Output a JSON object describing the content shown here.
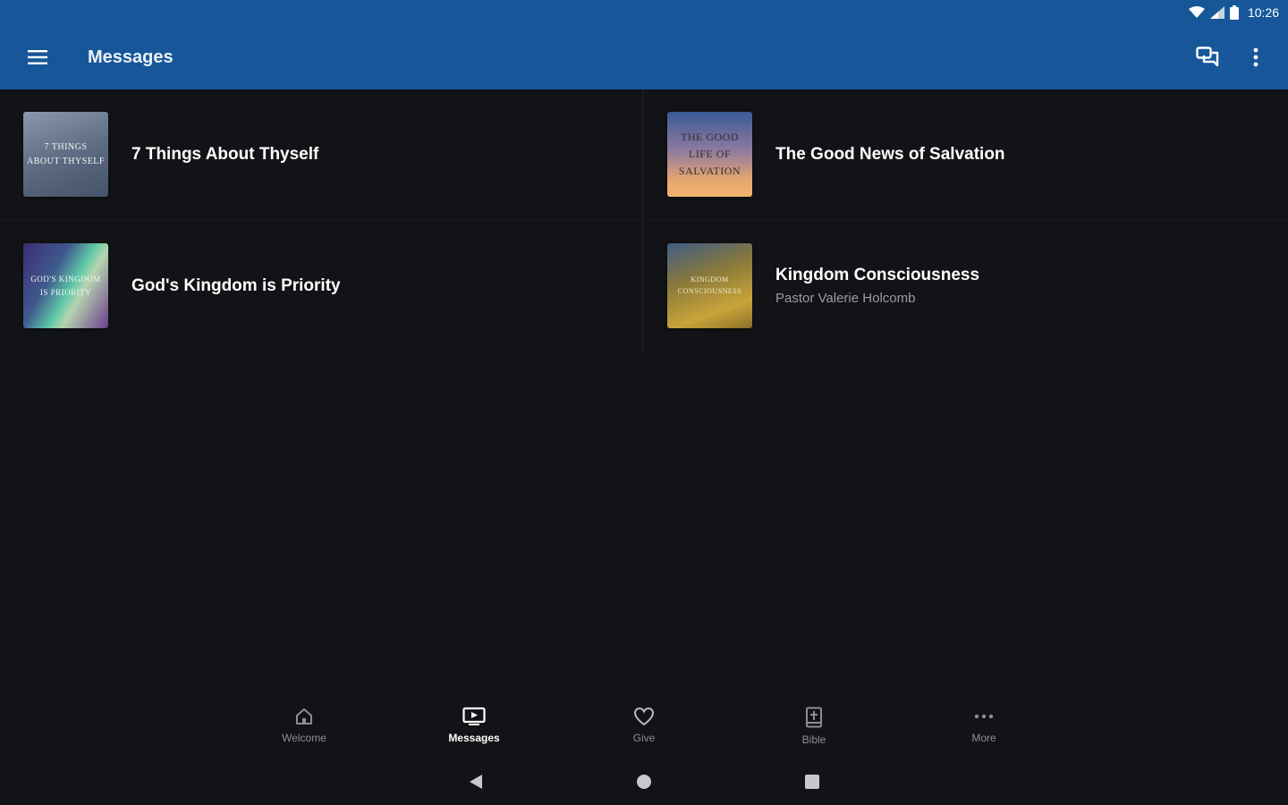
{
  "status": {
    "time": "10:26"
  },
  "appbar": {
    "title": "Messages"
  },
  "messages": [
    {
      "title": "7 Things About Thyself",
      "subtitle": "",
      "thumb_text": "7 Things About Thyself"
    },
    {
      "title": "The Good News of Salvation",
      "subtitle": "",
      "thumb_text": "The Good Life of Salvation"
    },
    {
      "title": "God's Kingdom is Priority",
      "subtitle": "",
      "thumb_text": "God's Kingdom is Priority"
    },
    {
      "title": "Kingdom Consciousness",
      "subtitle": "Pastor Valerie Holcomb",
      "thumb_text": "Kingdom Consciousness"
    }
  ],
  "bottom_nav": [
    {
      "label": "Welcome",
      "icon": "home-icon"
    },
    {
      "label": "Messages",
      "icon": "tv-icon"
    },
    {
      "label": "Give",
      "icon": "heart-icon"
    },
    {
      "label": "Bible",
      "icon": "bible-icon"
    },
    {
      "label": "More",
      "icon": "more-horizontal-icon"
    }
  ],
  "colors": {
    "appbar": "#175799",
    "background": "#121316",
    "inactive": "#8d8e92"
  }
}
